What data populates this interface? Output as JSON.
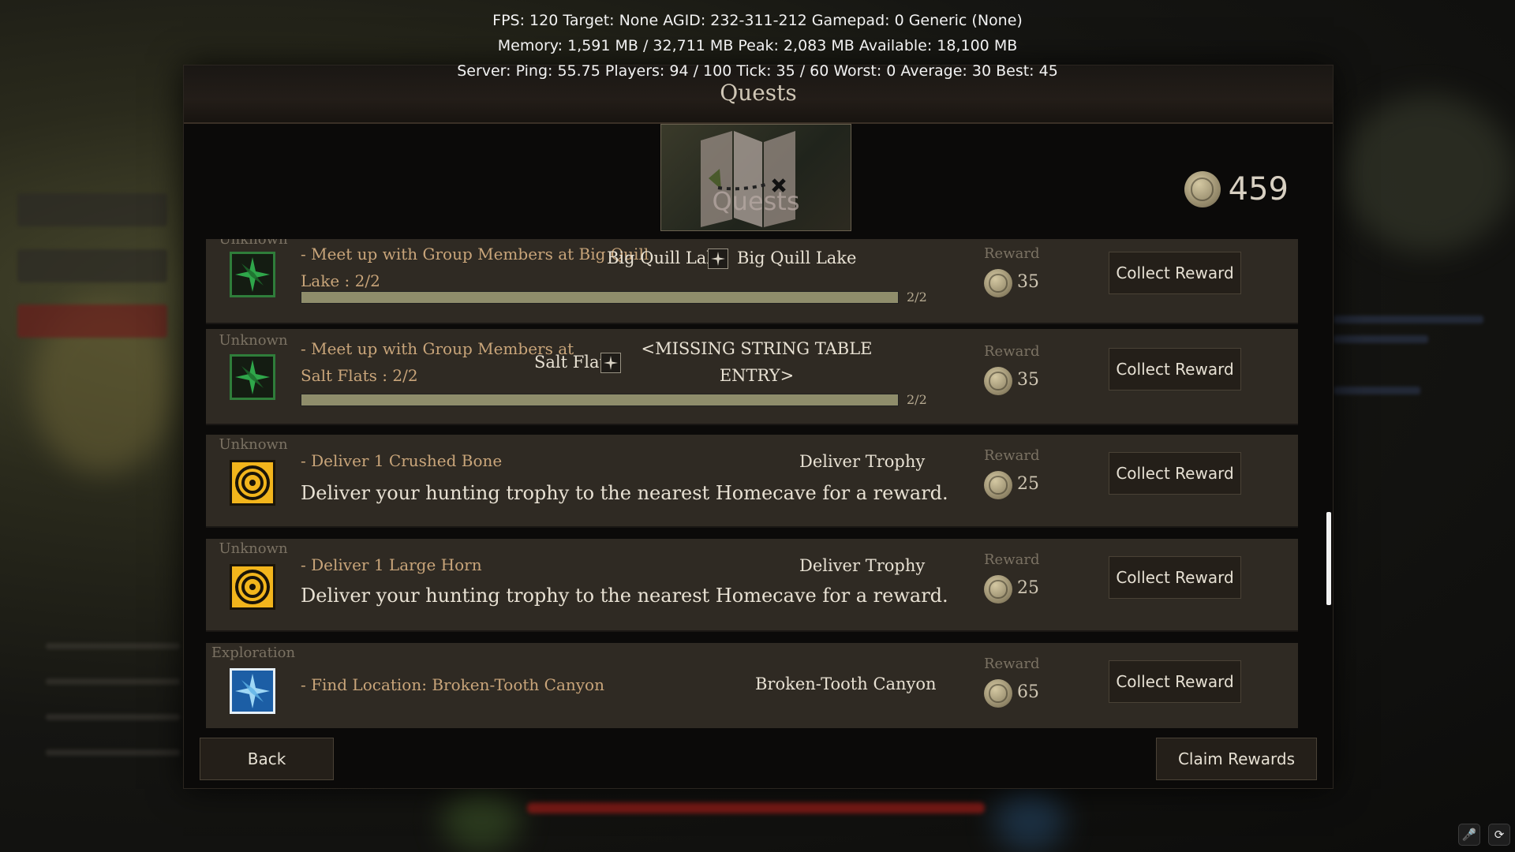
{
  "debug": {
    "line1": "FPS: 120 Target: None AGID: 232-311-212 Gamepad: 0 Generic (None)",
    "line2": "Memory: 1,591 MB / 32,711 MB Peak: 2,083 MB Available: 18,100 MB",
    "line3": "Server: Ping: 55.75 Players: 94 / 100 Tick: 35 / 60 Worst: 0 Average: 30 Best: 45"
  },
  "panel": {
    "title": "Quests",
    "emblem_label": "Quests",
    "currency_amount": "459"
  },
  "quests": [
    {
      "category": "Unknown",
      "icon": "green-compass-icon",
      "title_line1": "- Meet up with Group Members at Big Quill",
      "title_line2": "Lake : 2/2",
      "location": "Big Quill Lake",
      "destination": "Big Quill Lake",
      "progress_text": "2/2",
      "progress": 1.0,
      "reward_label": "Reward",
      "reward": "35",
      "button": "Collect Reward"
    },
    {
      "category": "Unknown",
      "icon": "green-compass-icon",
      "title_line1": "- Meet up with Group Members at",
      "title_line2": "Salt Flats : 2/2",
      "location": "Salt Flats",
      "destination_line1": "<MISSING STRING TABLE",
      "destination_line2": "ENTRY>",
      "progress_text": "2/2",
      "progress": 1.0,
      "reward_label": "Reward",
      "reward": "35",
      "button": "Collect Reward"
    },
    {
      "category": "Unknown",
      "icon": "target-icon",
      "title": "- Deliver 1 Crushed Bone",
      "location": "Deliver Trophy",
      "description": "Deliver your hunting trophy to the nearest Homecave for a reward.",
      "reward_label": "Reward",
      "reward": "25",
      "button": "Collect Reward"
    },
    {
      "category": "Unknown",
      "icon": "target-icon",
      "title": "- Deliver 1 Large Horn",
      "location": "Deliver Trophy",
      "description": "Deliver your hunting trophy to the nearest Homecave for a reward.",
      "reward_label": "Reward",
      "reward": "25",
      "button": "Collect Reward"
    },
    {
      "category": "Exploration",
      "icon": "blue-compass-icon",
      "title": "- Find Location: Broken-Tooth Canyon",
      "location": "Broken-Tooth Canyon",
      "reward_label": "Reward",
      "reward": "65",
      "button": "Collect Reward"
    }
  ],
  "footer": {
    "back": "Back",
    "claim": "Claim Rewards"
  },
  "colors": {
    "accent_title": "#c9a57a",
    "row_bg": "#2f2a23",
    "green_icon": "#2f7d3a",
    "orange_icon": "#f2b51c",
    "blue_icon": "#1c5ea5",
    "health_bar": "#8e1c18"
  },
  "system_icons": [
    "microphone-icon",
    "refresh-icon"
  ]
}
